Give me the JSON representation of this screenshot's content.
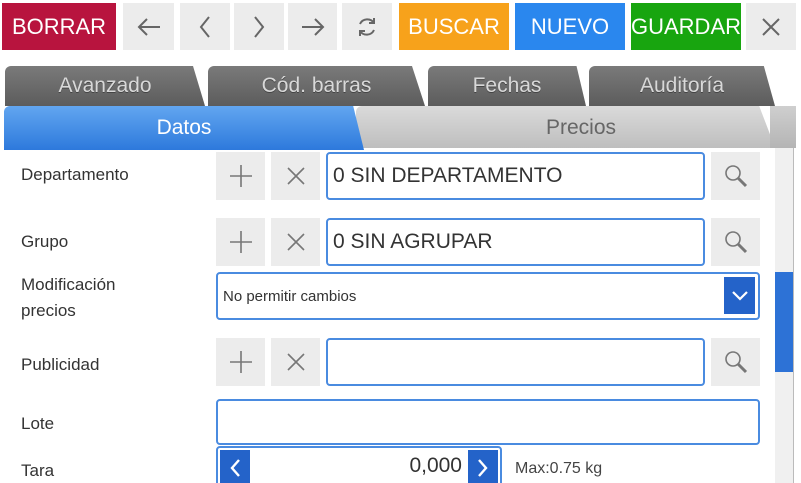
{
  "toolbar": {
    "delete_label": "BORRAR",
    "search_label": "BUSCAR",
    "new_label": "NUEVO",
    "save_label": "GUARDAR",
    "colors": {
      "delete": "#b8143e",
      "search": "#f7a21b",
      "new": "#2a87ee",
      "save": "#18a50f"
    }
  },
  "tabs": {
    "row1": [
      "Avanzado",
      "Cód. barras",
      "Fechas",
      "Auditoría"
    ],
    "row2": [
      "Datos",
      "Precios"
    ],
    "active": "Datos"
  },
  "form": {
    "departamento": {
      "label": "Departamento",
      "value": "0 SIN DEPARTAMENTO"
    },
    "grupo": {
      "label": "Grupo",
      "value": "0 SIN AGRUPAR"
    },
    "modificacion": {
      "label_line1": "Modificación",
      "label_line2": "precios",
      "value": "No permitir cambios"
    },
    "publicidad": {
      "label": "Publicidad",
      "value": ""
    },
    "lote": {
      "label": "Lote",
      "value": ""
    },
    "tara": {
      "label": "Tara",
      "value": "0,000",
      "max_text": "Max:0.75 kg"
    }
  },
  "icons": {
    "back": "arrow-left-icon",
    "prev": "chevron-left-icon",
    "next": "chevron-right-icon",
    "forward": "arrow-right-icon",
    "refresh": "refresh-icon",
    "close": "close-icon",
    "add": "plus-icon",
    "clear": "x-icon",
    "lookup": "magnifier-icon",
    "dropdown": "chevron-down-icon"
  }
}
